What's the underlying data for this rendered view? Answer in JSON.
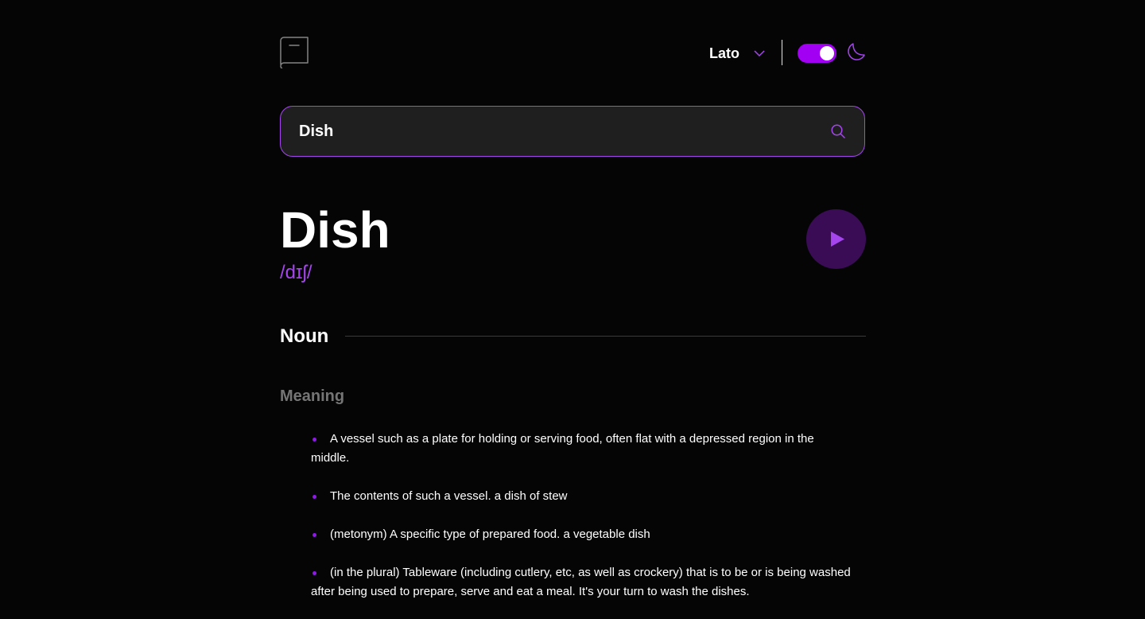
{
  "header": {
    "font_selected": "Lato",
    "theme_toggle_on": true,
    "accent_color": "#a445ed",
    "icons": [
      "book-icon",
      "chevron-down-icon",
      "moon-icon",
      "search-icon",
      "play-icon"
    ]
  },
  "search": {
    "value": "Dish",
    "placeholder": ""
  },
  "entry": {
    "word": "Dish",
    "phonetic": "/dɪʃ/",
    "part_of_speech": "Noun",
    "meaning_label": "Meaning",
    "meanings": [
      "A vessel such as a plate for holding or serving food, often flat with a depressed region in the middle.",
      "The contents of such a vessel. a dish of stew",
      "(metonym) A specific type of prepared food. a vegetable dish",
      "(in the plural) Tableware (including cutlery, etc, as well as crockery) that is to be or is being washed after being used to prepare, serve and eat a meal. It's your turn to wash the dishes."
    ]
  }
}
